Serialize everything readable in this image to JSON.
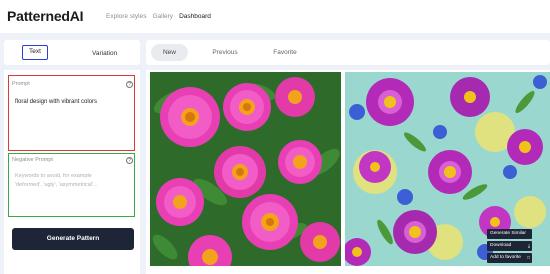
{
  "app": {
    "title": "PatternedAI"
  },
  "nav": {
    "items": [
      "Explore styles",
      "Gallery",
      "Dashboard"
    ]
  },
  "left_tabs": {
    "text": "Text",
    "variation": "Variation"
  },
  "result_tabs": {
    "new": "New",
    "previous": "Previous",
    "favorite": "Favorite"
  },
  "prompt": {
    "label": "Prompt",
    "value": "floral design with vibrant colors"
  },
  "negative_prompt": {
    "label": "Negative Prompt",
    "placeholder_line1": "Keywords to avoid, for example",
    "placeholder_line2": "'deformed', 'ugly', 'asymmetrical'..."
  },
  "generate_button": "Generate Pattern",
  "image_actions": {
    "similar": "Generate Similar",
    "download": "Download",
    "favorite": "Add to favorite"
  },
  "icons": {
    "help": "help-circle-icon",
    "download": "download-icon",
    "favorite": "bookmark-icon"
  },
  "colors": {
    "accent": "#2a3fd6",
    "primary_button": "#1e2536",
    "prompt_border": "#d93a3a",
    "negative_border": "#3aa84a"
  }
}
